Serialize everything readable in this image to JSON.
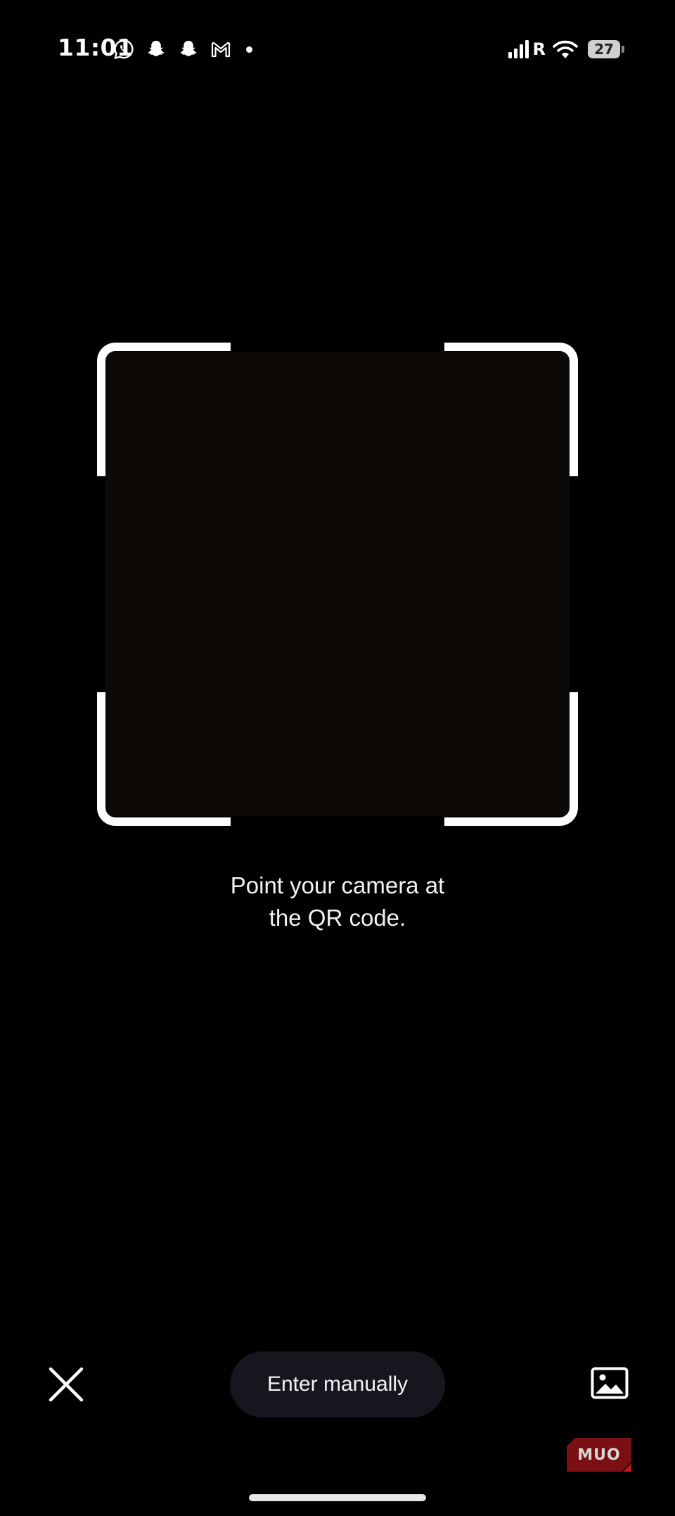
{
  "status_bar": {
    "time": "11:01",
    "notification_icons": [
      "whatsapp-icon",
      "snapchat-icon",
      "snapchat-icon",
      "gmail-icon"
    ],
    "roaming_indicator": "R",
    "battery_level": "27"
  },
  "scanner": {
    "instruction_line1": "Point your camera at",
    "instruction_line2": "the QR code.",
    "frame_color": "#ffffff"
  },
  "controls": {
    "close_icon": "close-icon",
    "enter_manually_label": "Enter manually",
    "gallery_icon": "gallery-icon"
  },
  "watermark": {
    "text": "MUO",
    "color": "#7a0f14"
  },
  "colors": {
    "background": "#000000",
    "button_background": "#16161f",
    "text": "#f2f2f2"
  }
}
